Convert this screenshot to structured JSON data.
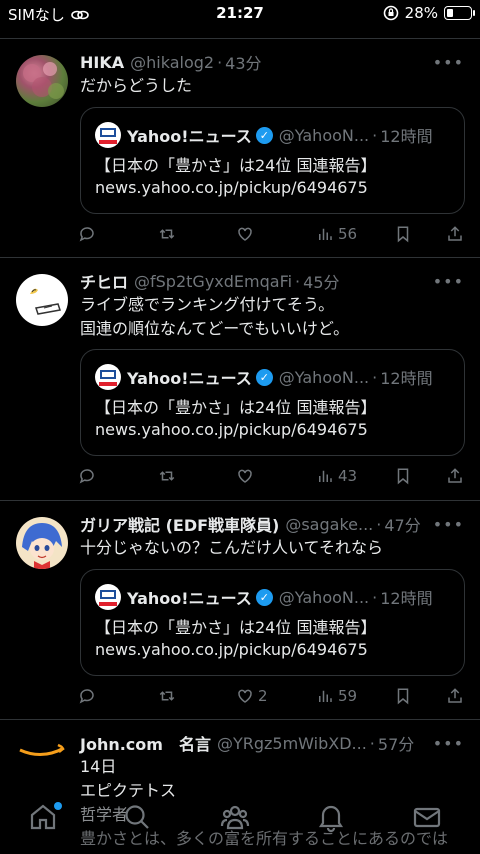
{
  "status": {
    "carrier": "SIMなし",
    "time": "21:27",
    "battery": "28%",
    "battery_level": 0.28
  },
  "tweets": [
    {
      "name": "HIKA",
      "handle": "@hikalog2",
      "time": "43分",
      "lines": [
        "だからどうした"
      ],
      "quote": {
        "name": "Yahoo!ニュース",
        "handle": "@YahooN...",
        "time": "12時間",
        "line1": "【日本の「豊かさ」は24位 国連報告】",
        "line2": "news.yahoo.co.jp/pickup/6494675"
      },
      "likes": "",
      "views": "56"
    },
    {
      "name": "チヒロ",
      "handle": "@fSp2tGyxdEmqaFi",
      "time": "45分",
      "lines": [
        "ライブ感でランキング付けてそう。",
        "国連の順位なんてどーでもいいけど。"
      ],
      "quote": {
        "name": "Yahoo!ニュース",
        "handle": "@YahooN...",
        "time": "12時間",
        "line1": "【日本の「豊かさ」は24位 国連報告】",
        "line2": "news.yahoo.co.jp/pickup/6494675"
      },
      "likes": "",
      "views": "43"
    },
    {
      "name": "ガリア戦記 (EDF戦車隊員)",
      "handle": "@sagake...",
      "time": "47分",
      "lines": [
        "十分じゃないの？こんだけ人いてそれなら"
      ],
      "quote": {
        "name": "Yahoo!ニュース",
        "handle": "@YahooN...",
        "time": "12時間",
        "line1": "【日本の「豊かさ」は24位 国連報告】",
        "line2": "news.yahoo.co.jp/pickup/6494675"
      },
      "likes": "2",
      "views": "59"
    },
    {
      "name": "John.com　名言",
      "handle": "@YRgz5mWibXD...",
      "time": "57分",
      "lines": [
        "14日",
        "エピクテトス",
        "哲学者",
        "豊かさとは、多くの富を所有することにあるのでは"
      ]
    }
  ],
  "more_glyph": "•••",
  "separator": "·",
  "colors": {
    "background": "#000000",
    "text": "#e7e9ea",
    "muted": "#71767b",
    "border": "#2f3336",
    "accent": "#1d9bf0"
  },
  "icons": [
    "reply-icon",
    "retweet-icon",
    "like-icon",
    "views-icon",
    "bookmark-icon",
    "share-icon",
    "home-icon",
    "search-icon",
    "communities-icon",
    "notifications-icon",
    "messages-icon"
  ]
}
